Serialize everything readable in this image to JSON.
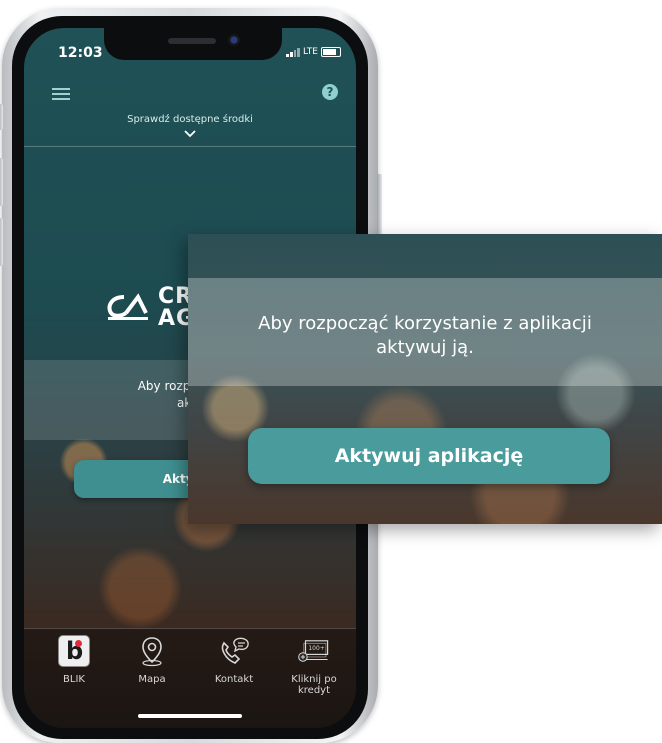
{
  "status_bar": {
    "time": "12:03",
    "network": "LTE"
  },
  "header": {
    "funds_label": "Sprawdź dostępne środki",
    "help_symbol": "?"
  },
  "logo": {
    "text_line1": "CR",
    "text_line2": "AG"
  },
  "main": {
    "message_line1": "Aby rozpocząć ko",
    "message_line2": "akty",
    "activate_label": "Aktywuj"
  },
  "tabs": [
    {
      "label": "BLIK",
      "icon": "blik-icon"
    },
    {
      "label": "Mapa",
      "icon": "map-pin-icon"
    },
    {
      "label": "Kontakt",
      "icon": "phone-chat-icon"
    },
    {
      "label": "Kliknij po kredyt",
      "icon": "money-100-icon",
      "badge": "100+"
    }
  ],
  "zoom": {
    "message_line1": "Aby rozpocząć korzystanie z aplikacji",
    "message_line2": "aktywuj ją.",
    "button_label": "Aktywuj aplikację"
  },
  "colors": {
    "screen_teal": "#1f5156",
    "button_teal": "#4a9b9c",
    "help_icon": "#8ed0d0",
    "blik_red": "#e12a3a"
  }
}
